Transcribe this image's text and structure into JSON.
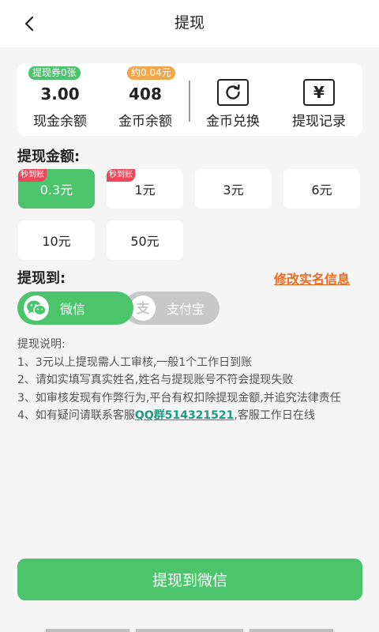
{
  "header": {
    "title": "提现"
  },
  "stats": {
    "cash": {
      "badge": "提现券0张",
      "value": "3.00",
      "label": "现金余额"
    },
    "coins": {
      "badge": "约0.04元",
      "value": "408",
      "label": "金币余额"
    },
    "exchange": {
      "icon": "refresh-icon",
      "label": "金币兑换"
    },
    "records": {
      "icon": "yen-icon",
      "icon_glyph": "¥",
      "label": "提现记录"
    }
  },
  "amount_section": {
    "title": "提现金额:",
    "fast_tag": "秒到账",
    "options": [
      {
        "label": "0.3元",
        "selected": true,
        "fast": true
      },
      {
        "label": "1元",
        "selected": false,
        "fast": true
      },
      {
        "label": "3元",
        "selected": false,
        "fast": false
      },
      {
        "label": "6元",
        "selected": false,
        "fast": false
      },
      {
        "label": "10元",
        "selected": false,
        "fast": false
      },
      {
        "label": "50元",
        "selected": false,
        "fast": false
      }
    ]
  },
  "withdraw_to": {
    "title": "提现到:",
    "edit_link": "修改实名信息",
    "wechat": {
      "label": "微信",
      "selected": true,
      "icon": "wechat-icon"
    },
    "alipay": {
      "label": "支付宝",
      "selected": false,
      "icon": "alipay-icon"
    }
  },
  "notes": {
    "heading": "提现说明:",
    "line1": "1、3元以上提现需人工审核,一般1个工作日到账",
    "line2": "2、请如实填写真实姓名,姓名与提现账号不符会提现失败",
    "line3": "3、如审核发现有作弊行为,平台有权扣除提现金额,并追究法律责任",
    "line4_prefix": "4、如有疑问请联系客服",
    "line4_link": "QQ群514321521",
    "line4_suffix": ",客服工作日在线"
  },
  "submit": {
    "label": "提现到微信"
  },
  "colors": {
    "accent": "#4cc46c",
    "link_orange": "#ef6a1f",
    "tag_red": "#f1455a",
    "badge_orange": "#f0a84a"
  }
}
